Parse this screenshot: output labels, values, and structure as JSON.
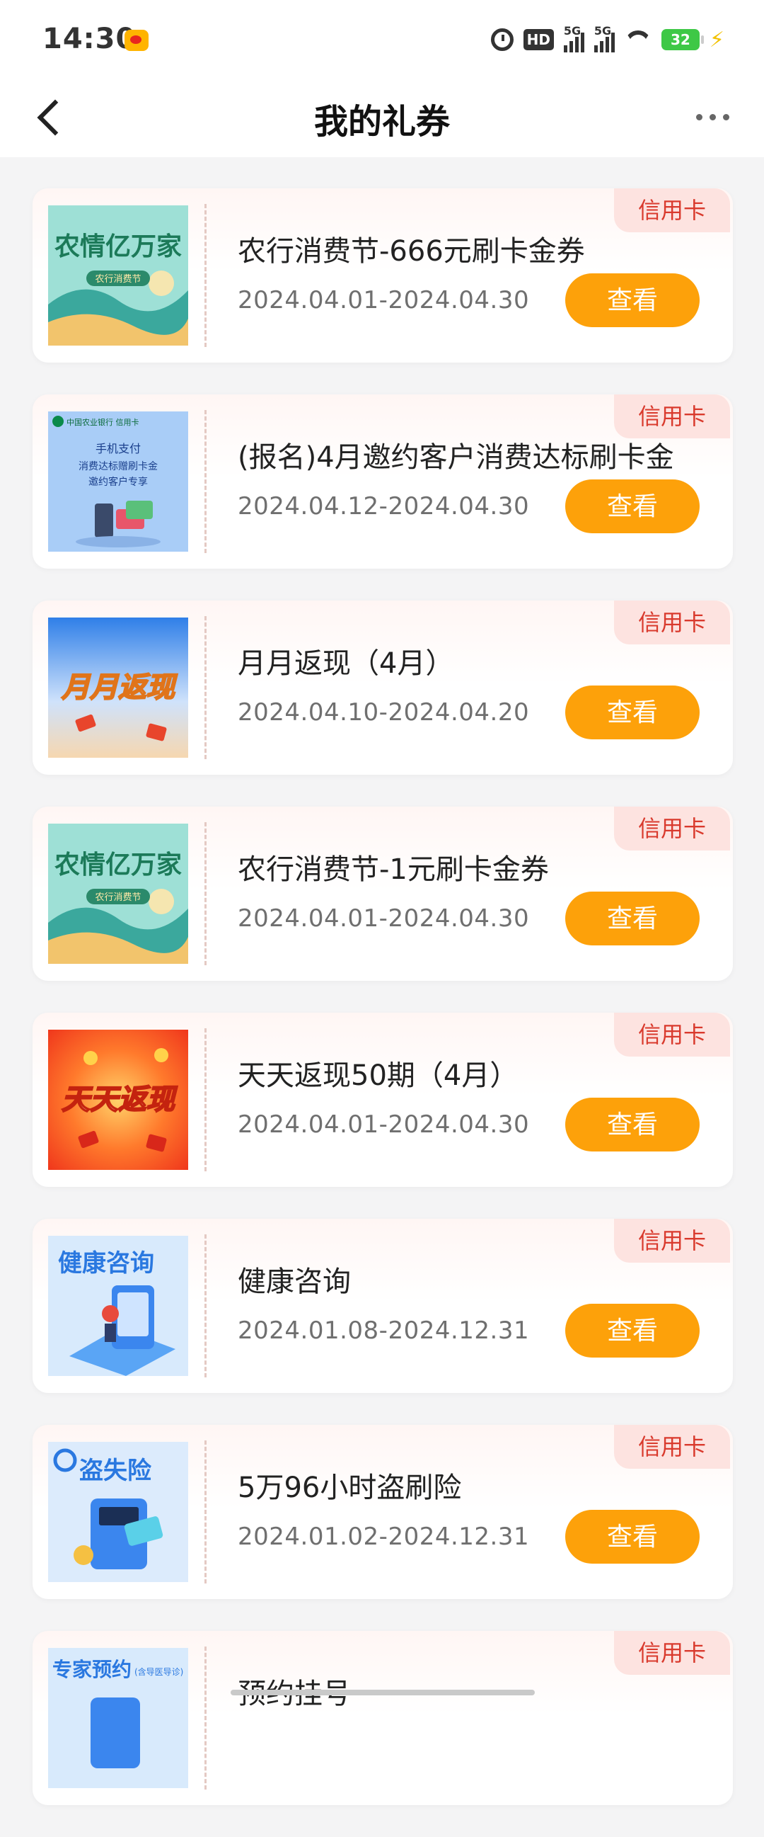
{
  "status_bar": {
    "time": "14:30",
    "hd": "HD",
    "network": "5G",
    "battery": "32",
    "icons": [
      "weibo-icon",
      "alarm-icon",
      "hd-icon",
      "signal-icon",
      "wifi-icon",
      "battery-icon",
      "charging-icon"
    ]
  },
  "header": {
    "title": "我的礼券",
    "back_icon": "chevron-left-icon",
    "more_icon": "more-dots-icon"
  },
  "colors": {
    "accent": "#fda10a",
    "tag_bg": "#fde3e0",
    "tag_text": "#d93a2d"
  },
  "coupons": [
    {
      "tag": "信用卡",
      "title": "农行消费节-666元刷卡金券",
      "date": "2024.04.01-2024.04.30",
      "button": "查看",
      "thumb": "农情亿万家",
      "thumb_sub": "农行消费节"
    },
    {
      "tag": "信用卡",
      "title": "(报名)4月邀约客户消费达标刷卡金",
      "date": "2024.04.12-2024.04.30",
      "button": "查看",
      "thumb_lines": [
        "中国农业银行 信用卡",
        "手机支付",
        "消费达标赠刷卡金",
        "邀约客户专享"
      ]
    },
    {
      "tag": "信用卡",
      "title": "月月返现（4月）",
      "date": "2024.04.10-2024.04.20",
      "button": "查看",
      "thumb": "月月返现"
    },
    {
      "tag": "信用卡",
      "title": "农行消费节-1元刷卡金券",
      "date": "2024.04.01-2024.04.30",
      "button": "查看",
      "thumb": "农情亿万家",
      "thumb_sub": "农行消费节"
    },
    {
      "tag": "信用卡",
      "title": "天天返现50期（4月）",
      "date": "2024.04.01-2024.04.30",
      "button": "查看",
      "thumb": "天天返现"
    },
    {
      "tag": "信用卡",
      "title": "健康咨询",
      "date": "2024.01.08-2024.12.31",
      "button": "查看",
      "thumb": "健康咨询"
    },
    {
      "tag": "信用卡",
      "title": "5万96小时盗刷险",
      "date": "2024.01.02-2024.12.31",
      "button": "查看",
      "thumb": "盗失险"
    },
    {
      "tag": "信用卡",
      "title": "预约挂号",
      "date": "",
      "button": "",
      "thumb": "专家预约",
      "thumb_sub": "(含导医导诊)"
    }
  ]
}
